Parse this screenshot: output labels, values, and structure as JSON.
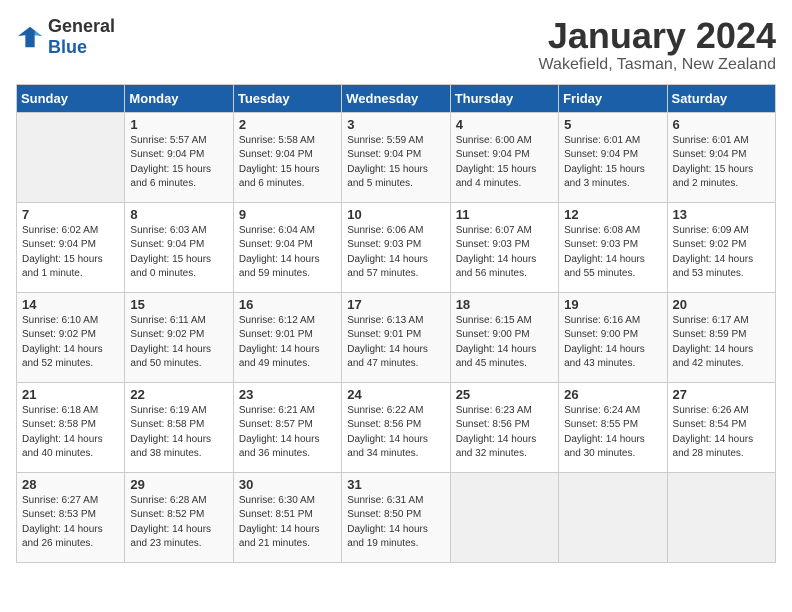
{
  "logo": {
    "general": "General",
    "blue": "Blue"
  },
  "header": {
    "month": "January 2024",
    "location": "Wakefield, Tasman, New Zealand"
  },
  "weekdays": [
    "Sunday",
    "Monday",
    "Tuesday",
    "Wednesday",
    "Thursday",
    "Friday",
    "Saturday"
  ],
  "weeks": [
    [
      {
        "day": "",
        "sunrise": "",
        "sunset": "",
        "daylight": ""
      },
      {
        "day": "1",
        "sunrise": "Sunrise: 5:57 AM",
        "sunset": "Sunset: 9:04 PM",
        "daylight": "Daylight: 15 hours and 6 minutes."
      },
      {
        "day": "2",
        "sunrise": "Sunrise: 5:58 AM",
        "sunset": "Sunset: 9:04 PM",
        "daylight": "Daylight: 15 hours and 6 minutes."
      },
      {
        "day": "3",
        "sunrise": "Sunrise: 5:59 AM",
        "sunset": "Sunset: 9:04 PM",
        "daylight": "Daylight: 15 hours and 5 minutes."
      },
      {
        "day": "4",
        "sunrise": "Sunrise: 6:00 AM",
        "sunset": "Sunset: 9:04 PM",
        "daylight": "Daylight: 15 hours and 4 minutes."
      },
      {
        "day": "5",
        "sunrise": "Sunrise: 6:01 AM",
        "sunset": "Sunset: 9:04 PM",
        "daylight": "Daylight: 15 hours and 3 minutes."
      },
      {
        "day": "6",
        "sunrise": "Sunrise: 6:01 AM",
        "sunset": "Sunset: 9:04 PM",
        "daylight": "Daylight: 15 hours and 2 minutes."
      }
    ],
    [
      {
        "day": "7",
        "sunrise": "Sunrise: 6:02 AM",
        "sunset": "Sunset: 9:04 PM",
        "daylight": "Daylight: 15 hours and 1 minute."
      },
      {
        "day": "8",
        "sunrise": "Sunrise: 6:03 AM",
        "sunset": "Sunset: 9:04 PM",
        "daylight": "Daylight: 15 hours and 0 minutes."
      },
      {
        "day": "9",
        "sunrise": "Sunrise: 6:04 AM",
        "sunset": "Sunset: 9:04 PM",
        "daylight": "Daylight: 14 hours and 59 minutes."
      },
      {
        "day": "10",
        "sunrise": "Sunrise: 6:06 AM",
        "sunset": "Sunset: 9:03 PM",
        "daylight": "Daylight: 14 hours and 57 minutes."
      },
      {
        "day": "11",
        "sunrise": "Sunrise: 6:07 AM",
        "sunset": "Sunset: 9:03 PM",
        "daylight": "Daylight: 14 hours and 56 minutes."
      },
      {
        "day": "12",
        "sunrise": "Sunrise: 6:08 AM",
        "sunset": "Sunset: 9:03 PM",
        "daylight": "Daylight: 14 hours and 55 minutes."
      },
      {
        "day": "13",
        "sunrise": "Sunrise: 6:09 AM",
        "sunset": "Sunset: 9:02 PM",
        "daylight": "Daylight: 14 hours and 53 minutes."
      }
    ],
    [
      {
        "day": "14",
        "sunrise": "Sunrise: 6:10 AM",
        "sunset": "Sunset: 9:02 PM",
        "daylight": "Daylight: 14 hours and 52 minutes."
      },
      {
        "day": "15",
        "sunrise": "Sunrise: 6:11 AM",
        "sunset": "Sunset: 9:02 PM",
        "daylight": "Daylight: 14 hours and 50 minutes."
      },
      {
        "day": "16",
        "sunrise": "Sunrise: 6:12 AM",
        "sunset": "Sunset: 9:01 PM",
        "daylight": "Daylight: 14 hours and 49 minutes."
      },
      {
        "day": "17",
        "sunrise": "Sunrise: 6:13 AM",
        "sunset": "Sunset: 9:01 PM",
        "daylight": "Daylight: 14 hours and 47 minutes."
      },
      {
        "day": "18",
        "sunrise": "Sunrise: 6:15 AM",
        "sunset": "Sunset: 9:00 PM",
        "daylight": "Daylight: 14 hours and 45 minutes."
      },
      {
        "day": "19",
        "sunrise": "Sunrise: 6:16 AM",
        "sunset": "Sunset: 9:00 PM",
        "daylight": "Daylight: 14 hours and 43 minutes."
      },
      {
        "day": "20",
        "sunrise": "Sunrise: 6:17 AM",
        "sunset": "Sunset: 8:59 PM",
        "daylight": "Daylight: 14 hours and 42 minutes."
      }
    ],
    [
      {
        "day": "21",
        "sunrise": "Sunrise: 6:18 AM",
        "sunset": "Sunset: 8:58 PM",
        "daylight": "Daylight: 14 hours and 40 minutes."
      },
      {
        "day": "22",
        "sunrise": "Sunrise: 6:19 AM",
        "sunset": "Sunset: 8:58 PM",
        "daylight": "Daylight: 14 hours and 38 minutes."
      },
      {
        "day": "23",
        "sunrise": "Sunrise: 6:21 AM",
        "sunset": "Sunset: 8:57 PM",
        "daylight": "Daylight: 14 hours and 36 minutes."
      },
      {
        "day": "24",
        "sunrise": "Sunrise: 6:22 AM",
        "sunset": "Sunset: 8:56 PM",
        "daylight": "Daylight: 14 hours and 34 minutes."
      },
      {
        "day": "25",
        "sunrise": "Sunrise: 6:23 AM",
        "sunset": "Sunset: 8:56 PM",
        "daylight": "Daylight: 14 hours and 32 minutes."
      },
      {
        "day": "26",
        "sunrise": "Sunrise: 6:24 AM",
        "sunset": "Sunset: 8:55 PM",
        "daylight": "Daylight: 14 hours and 30 minutes."
      },
      {
        "day": "27",
        "sunrise": "Sunrise: 6:26 AM",
        "sunset": "Sunset: 8:54 PM",
        "daylight": "Daylight: 14 hours and 28 minutes."
      }
    ],
    [
      {
        "day": "28",
        "sunrise": "Sunrise: 6:27 AM",
        "sunset": "Sunset: 8:53 PM",
        "daylight": "Daylight: 14 hours and 26 minutes."
      },
      {
        "day": "29",
        "sunrise": "Sunrise: 6:28 AM",
        "sunset": "Sunset: 8:52 PM",
        "daylight": "Daylight: 14 hours and 23 minutes."
      },
      {
        "day": "30",
        "sunrise": "Sunrise: 6:30 AM",
        "sunset": "Sunset: 8:51 PM",
        "daylight": "Daylight: 14 hours and 21 minutes."
      },
      {
        "day": "31",
        "sunrise": "Sunrise: 6:31 AM",
        "sunset": "Sunset: 8:50 PM",
        "daylight": "Daylight: 14 hours and 19 minutes."
      },
      {
        "day": "",
        "sunrise": "",
        "sunset": "",
        "daylight": ""
      },
      {
        "day": "",
        "sunrise": "",
        "sunset": "",
        "daylight": ""
      },
      {
        "day": "",
        "sunrise": "",
        "sunset": "",
        "daylight": ""
      }
    ]
  ]
}
